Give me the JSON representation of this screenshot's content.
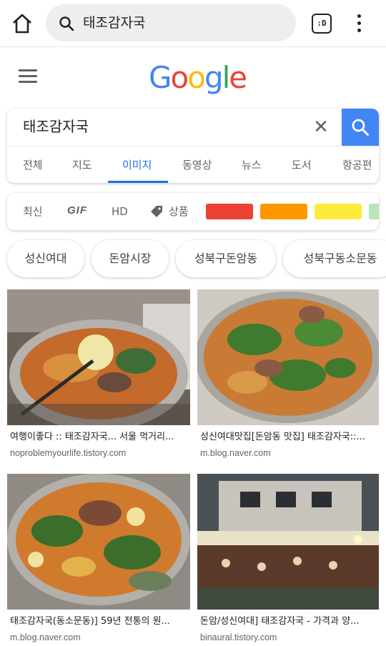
{
  "browser": {
    "url_text": "태조감자국",
    "tabs_label": ":D",
    "icons": [
      "home-icon",
      "search-icon",
      "tabs-icon",
      "more-vert-icon"
    ]
  },
  "header": {
    "logo_letters": [
      "G",
      "o",
      "o",
      "g",
      "l",
      "e"
    ],
    "logo_colors": [
      "#4285F4",
      "#EA4335",
      "#FBBC05",
      "#4285F4",
      "#34A853",
      "#EA4335"
    ]
  },
  "search": {
    "query": "태조감자국",
    "clear_label": "✕",
    "tabs": [
      "전체",
      "지도",
      "이미지",
      "동영상",
      "뉴스",
      "도서",
      "항공편"
    ],
    "active_tab": "이미지",
    "accent": "#1a73e8",
    "search_button_color": "#4285F4"
  },
  "filters": {
    "recent": "최신",
    "gif": "GIF",
    "hd": "HD",
    "product": "상품",
    "color_swatches": [
      "#EA4335",
      "#FF9800",
      "#FFEB3B",
      "#B9E5B8"
    ]
  },
  "related": [
    "성신여대",
    "돈암시장",
    "성북구돈암동",
    "성북구동소문동"
  ],
  "results": [
    {
      "title": "여행이좋다 :: 태조감자국... 서울 먹거리...",
      "source": "noproblemyourlife.tistory.com"
    },
    {
      "title": "성신여대맛집[돈암동 맛집] 태조감자국::...",
      "source": "m.blog.naver.com"
    },
    {
      "title": "태조감자국(동소문동)] 59년 전통의 원...",
      "source": "m.blog.naver.com"
    },
    {
      "title": "돈암/성신여대] 태조감자국 - 가격과 양...",
      "source": "binaural.tistory.com"
    }
  ]
}
